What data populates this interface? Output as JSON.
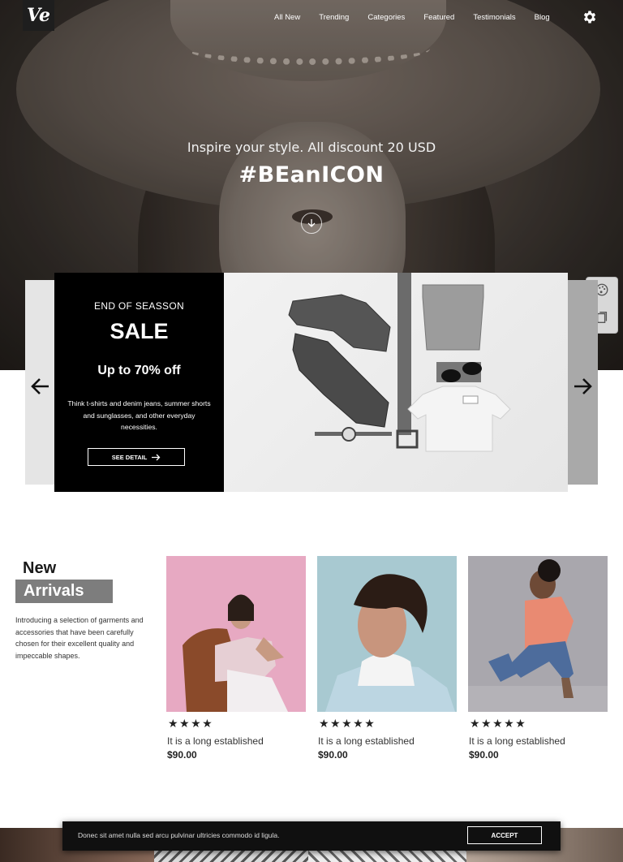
{
  "brand": {
    "logo_text": "Ve"
  },
  "nav": {
    "items": [
      "All New",
      "Trending",
      "Categories",
      "Featured",
      "Testimonials",
      "Blog"
    ],
    "settings_icon": "gear-icon"
  },
  "hero": {
    "subtitle": "Inspire your style. All discount 20 USD",
    "title": "#BEanICON",
    "scroll_icon": "arrow-down-circle-icon"
  },
  "side_widget": {
    "icons": [
      "palette-icon",
      "bookmarks-icon"
    ]
  },
  "promo": {
    "eyebrow": "END OF SEASSON",
    "title": "SALE",
    "offer": "Up to 70% off",
    "description": "Think t-shirts and denim jeans, summer shorts and sunglasses, and other everyday necessities.",
    "button_label": "SEE DETAIL"
  },
  "new_arrivals": {
    "title_line1": "New",
    "title_line2": "Arrivals",
    "description": "Introducing a selection of garments and accessories that have been carefully chosen for their excellent quality and impeccable shapes.",
    "products": [
      {
        "stars": "★★★★",
        "rating": 4,
        "name": "It is a long established",
        "price": "$90.00"
      },
      {
        "stars": "★★★★★",
        "rating": 5,
        "name": "It is a long established",
        "price": "$90.00"
      },
      {
        "stars": "★★★★★",
        "rating": 5,
        "name": "It is a long established",
        "price": "$90.00"
      }
    ]
  },
  "cookie": {
    "text": "Donec sit amet nulla sed arcu pulvinar ultricies commodo id ligula.",
    "button_label": "ACCEPT"
  },
  "colors": {
    "accent_gray": "#7d7d7d",
    "black": "#000000"
  }
}
